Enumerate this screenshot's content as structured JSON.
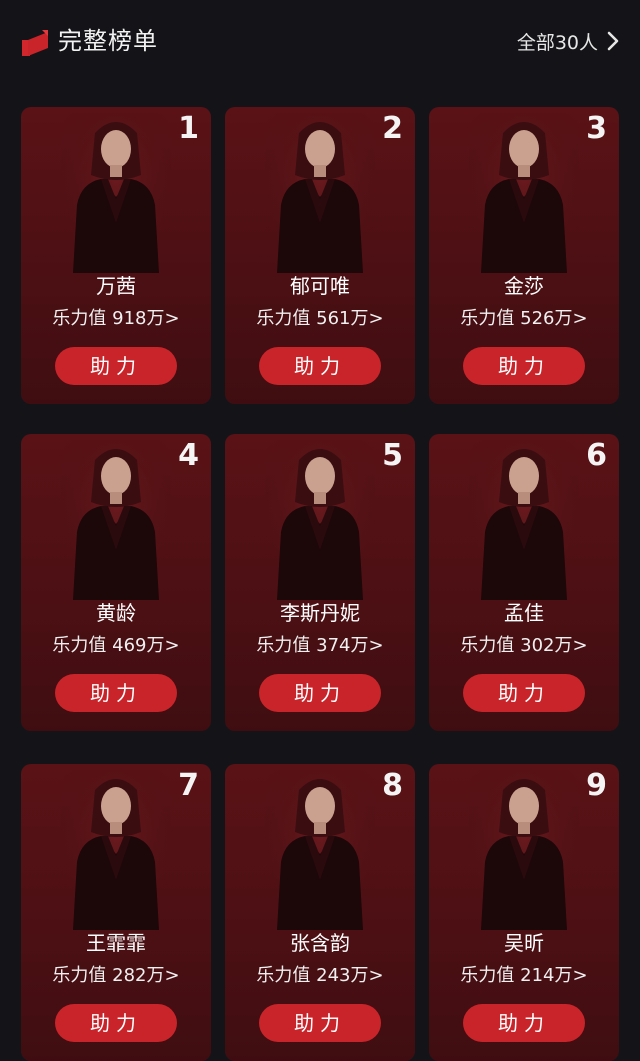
{
  "header": {
    "title": "完整榜单",
    "all_label": "全部30人"
  },
  "cards": [
    {
      "rank": "1",
      "name": "万茜",
      "score": "乐力值 918万>",
      "button": "助力"
    },
    {
      "rank": "2",
      "name": "郁可唯",
      "score": "乐力值 561万>",
      "button": "助力"
    },
    {
      "rank": "3",
      "name": "金莎",
      "score": "乐力值 526万>",
      "button": "助力"
    },
    {
      "rank": "4",
      "name": "黄龄",
      "score": "乐力值 469万>",
      "button": "助力"
    },
    {
      "rank": "5",
      "name": "李斯丹妮",
      "score": "乐力值 374万>",
      "button": "助力"
    },
    {
      "rank": "6",
      "name": "孟佳",
      "score": "乐力值 302万>",
      "button": "助力"
    },
    {
      "rank": "7",
      "name": "王霏霏",
      "score": "乐力值 282万>",
      "button": "助力"
    },
    {
      "rank": "8",
      "name": "张含韵",
      "score": "乐力值 243万>",
      "button": "助力"
    },
    {
      "rank": "9",
      "name": "吴昕",
      "score": "乐力值 214万>",
      "button": "助力"
    }
  ],
  "colors": {
    "background": "#141418",
    "card": "#4c1014",
    "button": "#c8242a"
  },
  "icons": {
    "logo": "ranking-logo-icon",
    "chevron": "chevron-right-icon",
    "portrait": "portrait-photo"
  }
}
